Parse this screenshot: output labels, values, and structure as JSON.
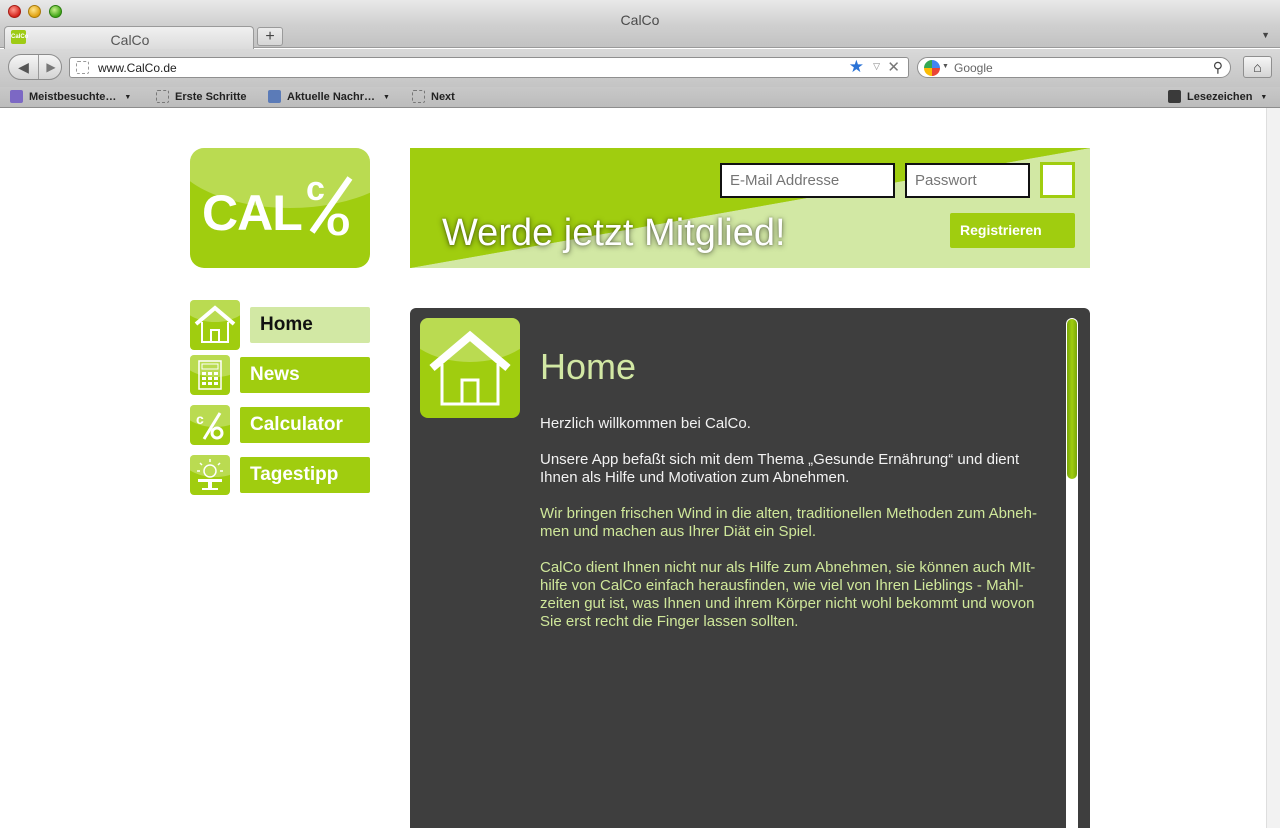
{
  "browser": {
    "window_title": "CalCo",
    "tab_label": "CalCo",
    "tab_favicon_text": "CalCo",
    "new_tab_symbol": "+",
    "url": "www.CalCo.de",
    "search_placeholder": "Google",
    "bookmarks": [
      {
        "label": "Meistbesuchte…",
        "icon": "most-visited-icon",
        "has_menu": true
      },
      {
        "label": "Erste Schritte",
        "icon": "page-icon",
        "has_menu": false
      },
      {
        "label": "Aktuelle Nachr…",
        "icon": "rss-icon",
        "has_menu": true
      },
      {
        "label": "Next",
        "icon": "page-icon",
        "has_menu": false
      }
    ],
    "bookmarks_menu_label": "Lesezeichen"
  },
  "site": {
    "brand_color": "#a0cd0f",
    "light_green": "#d2e8a4",
    "logo": {
      "text": "CAL",
      "c": "c",
      "o": "o"
    },
    "banner": {
      "headline": "Werde jetzt Mitglied!",
      "email_placeholder": "E-Mail Addresse",
      "password_placeholder": "Passwort",
      "register_label": "Registrieren"
    },
    "nav": [
      {
        "label": "Home",
        "icon": "house-icon",
        "active": true
      },
      {
        "label": "News",
        "icon": "calculator-keypad-icon",
        "active": false
      },
      {
        "label": "Calculator",
        "icon": "percent-icon",
        "active": false
      },
      {
        "label": "Tagestipp",
        "icon": "lightbulb-icon",
        "active": false
      }
    ],
    "content": {
      "title": "Home",
      "paragraphs": [
        "Herzlich willkommen bei CalCo.",
        "Unsere App befaßt sich mit dem Thema „Gesunde Ernährung“ und dient Ihnen als Hilfe und Motivation zum Abnehmen.",
        "Wir bringen frischen Wind in die alten, traditionellen Methoden zum Abneh-men und machen aus Ihrer Diät ein Spiel.",
        "CalCo dient Ihnen nicht nur als Hilfe zum Abnehmen, sie können auch MIt-hilfe von CalCo einfach herausfinden, wie viel von Ihren Lieblings - Mahl-zeiten gut ist, was Ihnen und ihrem Körper nicht wohl bekommt und wovon Sie erst recht die Finger lassen sollten."
      ]
    }
  }
}
